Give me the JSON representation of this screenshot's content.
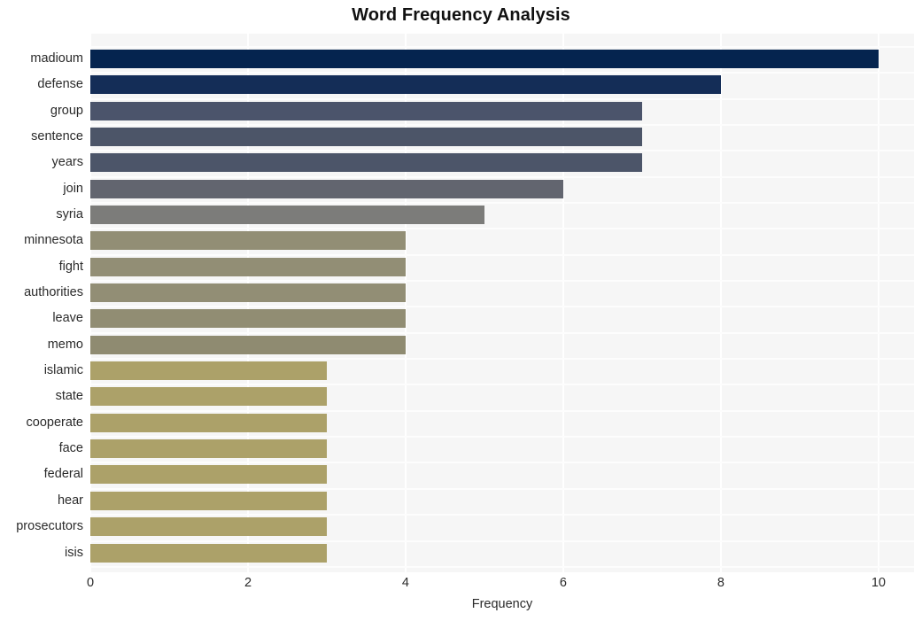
{
  "chart_data": {
    "type": "bar",
    "orientation": "horizontal",
    "title": "Word Frequency Analysis",
    "xlabel": "Frequency",
    "ylabel": "",
    "xlim": [
      0,
      10.45
    ],
    "xticks": [
      0,
      2,
      4,
      6,
      8,
      10
    ],
    "xtick_labels": [
      "0",
      "2",
      "4",
      "6",
      "8",
      "10"
    ],
    "grid": true,
    "legend": null,
    "plot_background": "#f6f6f6",
    "gridline_color": "#ffffff",
    "categories": [
      "madioum",
      "defense",
      "group",
      "sentence",
      "years",
      "join",
      "syria",
      "minnesota",
      "fight",
      "authorities",
      "leave",
      "memo",
      "islamic",
      "state",
      "cooperate",
      "face",
      "federal",
      "hear",
      "prosecutors",
      "isis"
    ],
    "values": [
      10,
      8,
      7,
      7,
      7,
      6,
      5,
      4,
      4,
      4,
      4,
      4,
      3,
      3,
      3,
      3,
      3,
      3,
      3,
      3
    ],
    "bar_colors": [
      "#05244f",
      "#364около",
      "#4b546b",
      "#4c5568",
      "#4c5569",
      "#62656f",
      "#7c7c7a",
      "#928e75",
      "#928e75",
      "#928e75",
      "#918d73",
      "#8f8b71",
      "#aca169",
      "#aca169",
      "#aca169",
      "#aca169",
      "#aca169",
      "#aca169",
      "#aca169",
      "#aca169"
    ],
    "palette_note": "sequential dark-navy to khaki"
  },
  "chart": {
    "title": "Word Frequency Analysis",
    "x_axis_title": "Frequency"
  }
}
